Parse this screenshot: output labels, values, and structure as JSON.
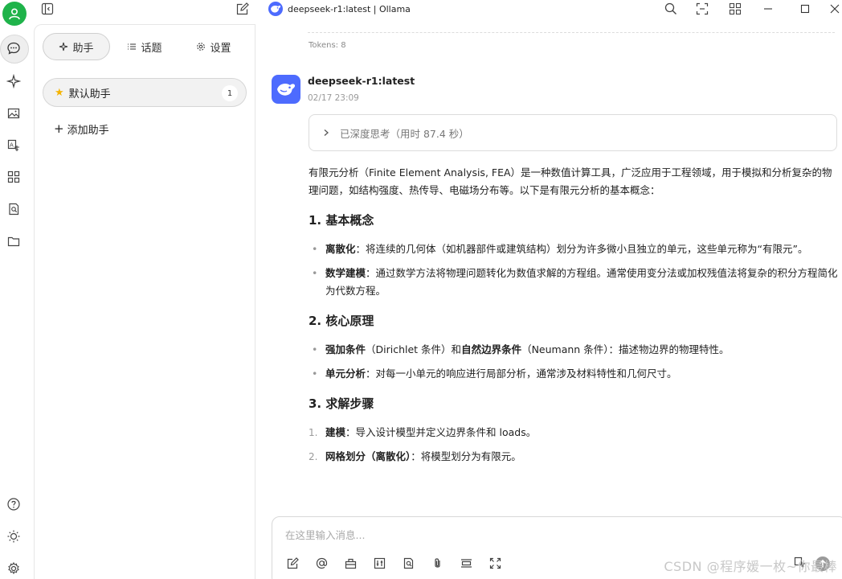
{
  "window": {
    "title": "deepseek-r1:latest | Ollama"
  },
  "sidebar_tabs": {
    "assistant": "助手",
    "topics": "话题",
    "settings": "设置"
  },
  "assistants": [
    {
      "name": "默认助手",
      "count": "1"
    }
  ],
  "add_assistant_label": "添加助手",
  "chat": {
    "tokens": "Tokens: 8",
    "model_name": "deepseek-r1:latest",
    "timestamp": "02/17 23:09",
    "thinking": "已深度思考（用时 87.4 秒）",
    "intro": "有限元分析（Finite Element Analysis, FEA）是一种数值计算工具，广泛应用于工程领域，用于模拟和分析复杂的物理问题，如结构强度、热传导、电磁场分布等。以下是有限元分析的基本概念：",
    "sections": [
      {
        "heading": "1. 基本概念",
        "items": [
          {
            "bold": "离散化",
            "text": "：将连续的几何体（如机器部件或建筑结构）划分为许多微小且独立的单元，这些单元称为“有限元”。"
          },
          {
            "bold": "数学建模",
            "text": "：通过数学方法将物理问题转化为数值求解的方程组。通常使用变分法或加权残值法将复杂的积分方程简化为代数方程。"
          }
        ]
      },
      {
        "heading": "2. 核心原理",
        "items": [
          {
            "bold": "强加条件",
            "text": "（Dirichlet 条件）和",
            "bold2": "自然边界条件",
            "text2": "（Neumann 条件）：描述物边界的物理特性。"
          },
          {
            "bold": "单元分析",
            "text": "：对每一小单元的响应进行局部分析，通常涉及材料特性和几何尺寸。"
          }
        ]
      },
      {
        "heading": "3. 求解步骤",
        "items": [
          {
            "num": "1.",
            "bold": "建模",
            "text": "：导入设计模型并定义边界条件和 loads。"
          },
          {
            "num": "2.",
            "bold": "网格划分（离散化）",
            "text": "：将模型划分为有限元。"
          }
        ]
      }
    ]
  },
  "input": {
    "placeholder": "在这里输入消息..."
  },
  "watermark": "CSDN @程序媛一枚~你最棒",
  "colors": {
    "accent_green": "#1fb34a",
    "deepseek_blue": "#4d6bfe"
  },
  "icons": [
    "avatar-icon",
    "chat-icon",
    "sparkle-icon",
    "image-icon",
    "translate-icon",
    "apps-icon",
    "doc-search-icon",
    "folder-icon",
    "help-icon",
    "sun-icon",
    "settings-gear-icon",
    "sidebar-toggle-icon",
    "new-chat-icon",
    "search-icon",
    "expand-icon",
    "grid-icon",
    "minimize-icon",
    "maximize-icon",
    "close-icon"
  ]
}
